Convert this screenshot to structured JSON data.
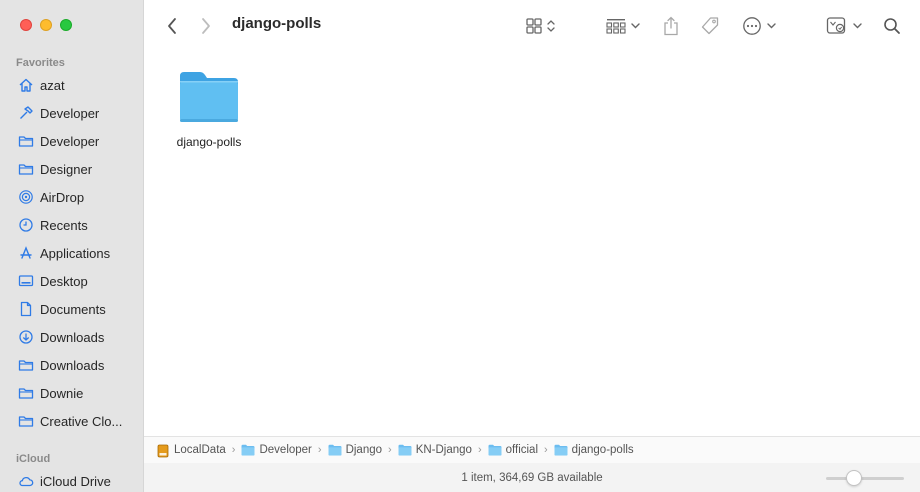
{
  "window": {
    "title": "django-polls"
  },
  "colors": {
    "accent": "#2f7be6",
    "folder_blue": "#5ab6ef"
  },
  "sidebar": {
    "favorites_title": "Favorites",
    "favorites": [
      {
        "label": "azat",
        "icon": "home-icon"
      },
      {
        "label": "Developer",
        "icon": "hammer-icon"
      },
      {
        "label": "Developer",
        "icon": "folder-icon"
      },
      {
        "label": "Designer",
        "icon": "folder-icon"
      },
      {
        "label": "AirDrop",
        "icon": "airdrop-icon"
      },
      {
        "label": "Recents",
        "icon": "clock-icon"
      },
      {
        "label": "Applications",
        "icon": "applications-icon"
      },
      {
        "label": "Desktop",
        "icon": "desktop-icon"
      },
      {
        "label": "Documents",
        "icon": "document-icon"
      },
      {
        "label": "Downloads",
        "icon": "download-icon"
      },
      {
        "label": "Downloads",
        "icon": "folder-icon"
      },
      {
        "label": "Downie",
        "icon": "folder-icon"
      },
      {
        "label": "Creative Clo...",
        "icon": "folder-icon"
      }
    ],
    "icloud_title": "iCloud",
    "icloud": [
      {
        "label": "iCloud Drive",
        "icon": "cloud-icon"
      }
    ]
  },
  "content": {
    "items": [
      {
        "name": "django-polls",
        "icon": "folder-icon"
      }
    ]
  },
  "pathbar": {
    "crumbs": [
      {
        "label": "LocalData",
        "icon": "drive-icon"
      },
      {
        "label": "Developer",
        "icon": "folder-icon"
      },
      {
        "label": "Django",
        "icon": "folder-icon"
      },
      {
        "label": "KN-Django",
        "icon": "folder-icon"
      },
      {
        "label": "official",
        "icon": "folder-icon"
      },
      {
        "label": "django-polls",
        "icon": "folder-icon"
      }
    ],
    "separator": "›"
  },
  "status": {
    "text": "1 item, 364,69 GB available",
    "zoom_level": 0.25
  }
}
